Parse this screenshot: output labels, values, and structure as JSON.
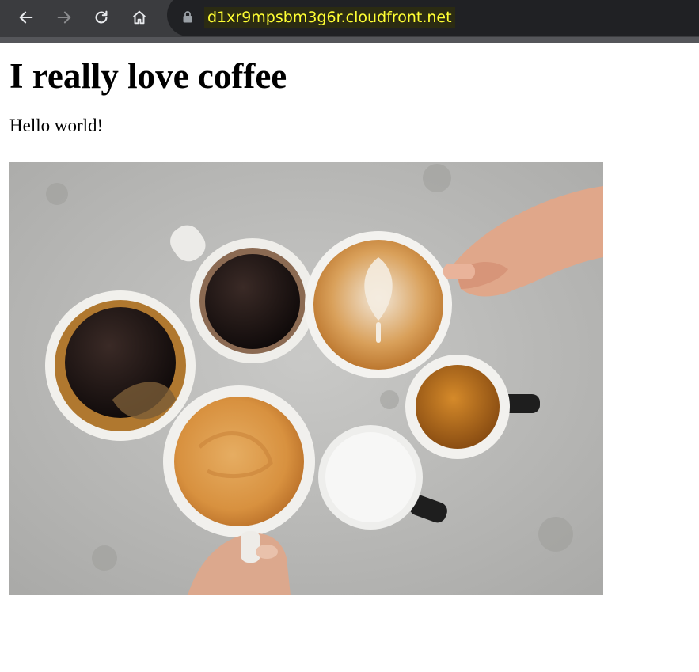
{
  "browser": {
    "url": "d1xr9mpsbm3g6r.cloudfront.net",
    "icons": [
      "back-icon",
      "forward-icon",
      "reload-icon",
      "home-icon",
      "lock-icon"
    ]
  },
  "page": {
    "title": "I really love coffee",
    "greeting": "Hello world!",
    "image": {
      "subject": "coffee-cups-photo"
    }
  }
}
